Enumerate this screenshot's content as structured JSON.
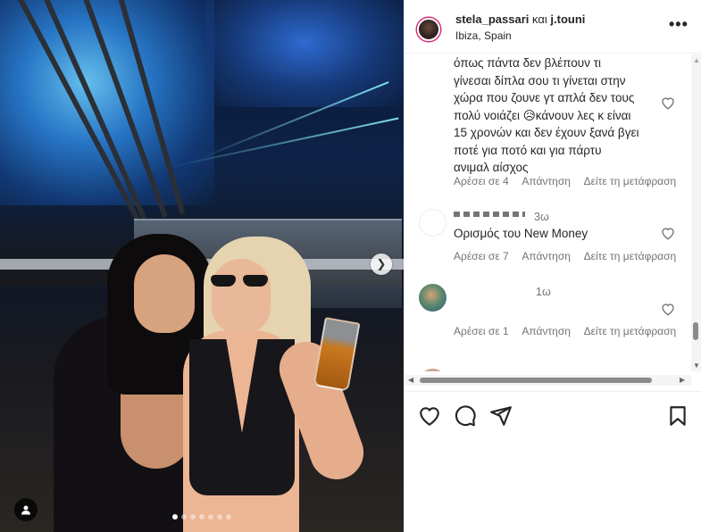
{
  "post": {
    "photo_alt": "",
    "carousel_dot_count": 7,
    "carousel_active_index": 0
  },
  "header": {
    "user1": "stela_passari",
    "conjunction": "και",
    "user2": "j.touni",
    "location": "Ibiza, Spain",
    "more_label": "•••"
  },
  "comments": [
    {
      "text_lines": [
        "όπως πάντα δεν βλέπουν τι",
        "γίνεσαι δίπλα σου τι γίνεται στην",
        "χώρα που ζουνε γτ απλά δεν τους",
        "πολύ νοιάζει 😥κάνουν λες κ είναι",
        "15 χρονών και δεν έχουν ξανά βγει",
        "ποτέ για ποτό και για πάρτυ",
        "ανιμαλ αίσχος"
      ],
      "likes": "Αρέσει σε 4",
      "reply": "Απάντηση",
      "translate": "Δείτε τη μετάφραση"
    },
    {
      "time": "3ω",
      "text": "Ορισμός του New Money",
      "likes": "Αρέσει σε 7",
      "reply": "Απάντηση",
      "translate": "Δείτε τη μετάφραση"
    },
    {
      "time": "1ω",
      "text": "",
      "likes": "Αρέσει σε 1",
      "reply": "Απάντηση",
      "translate": "Δείτε τη μετάφραση"
    }
  ],
  "icons": {
    "like": "heart-icon",
    "comment": "comment-icon",
    "share": "send-icon",
    "save": "bookmark-icon",
    "tag": "user-tag-icon",
    "next": "chevron-right-icon"
  },
  "colors": {
    "story_ring": "#d62976",
    "meta_text": "#737373",
    "primary_text": "#262626"
  }
}
